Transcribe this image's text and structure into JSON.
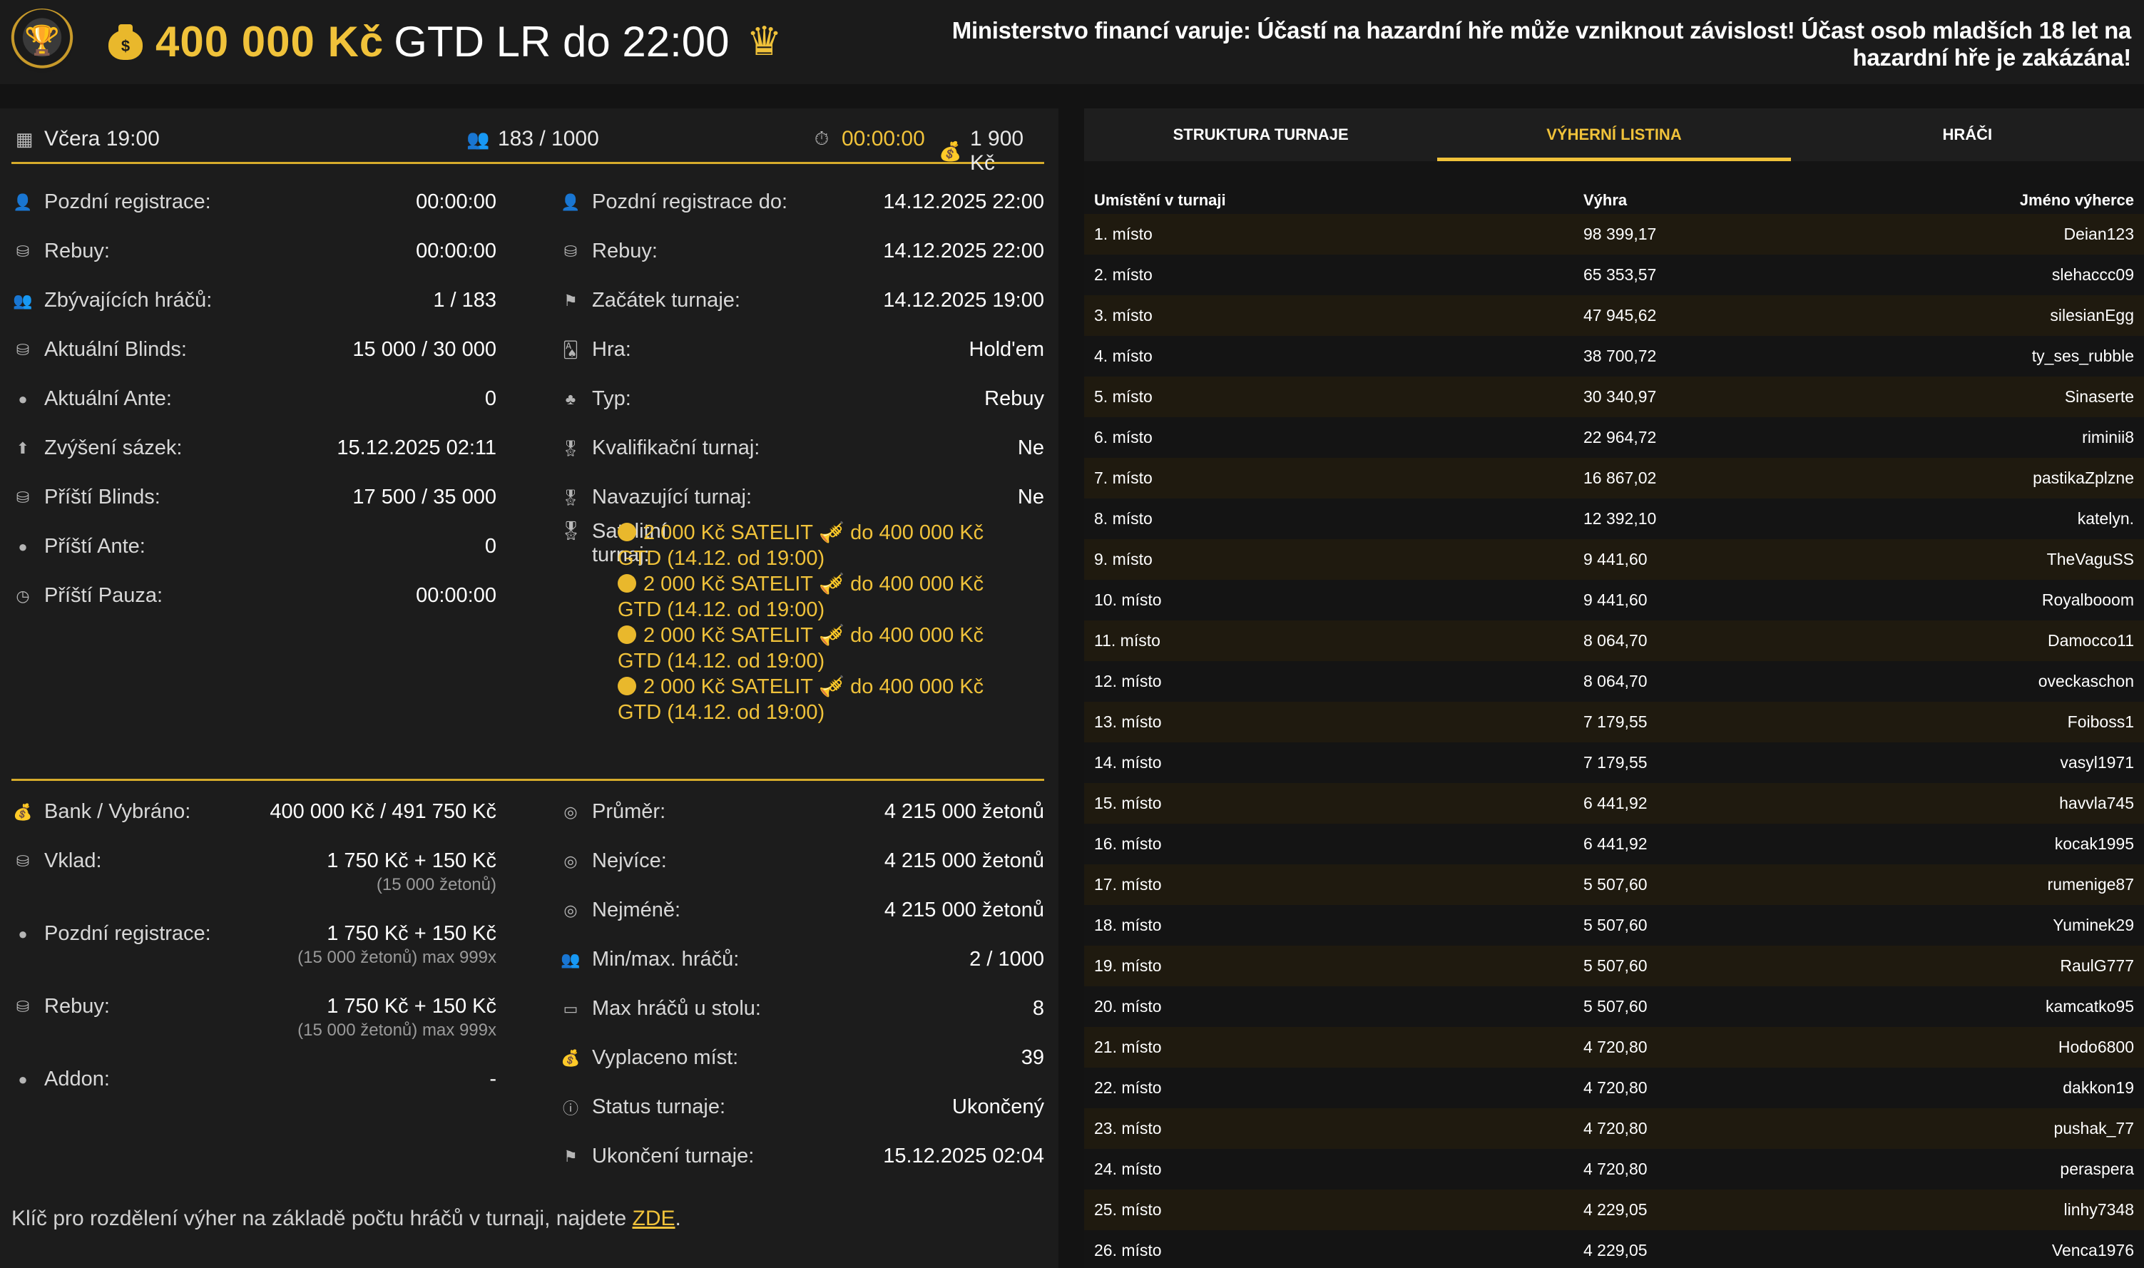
{
  "header": {
    "title_amount": "400 000 Kč",
    "title_rest": "GTD LR do 22:00",
    "warning": "Ministerstvo financí varuje: Účastí na hazardní hře může vzniknout závislost! Účast osob mladších 18 let na hazardní hře je zakázána!"
  },
  "topbar": {
    "date": "Včera 19:00",
    "players": "183 / 1000",
    "timer": "00:00:00",
    "fee": "1 900 Kč"
  },
  "col1": [
    {
      "label": "Pozdní registrace:",
      "value": "00:00:00"
    },
    {
      "label": "Rebuy:",
      "value": "00:00:00"
    },
    {
      "label": "Zbývajících hráčů:",
      "value": "1 / 183"
    },
    {
      "label": "Aktuální Blinds:",
      "value": "15 000 / 30 000"
    },
    {
      "label": "Aktuální Ante:",
      "value": "0"
    },
    {
      "label": "Zvýšení sázek:",
      "value": "15.12.2025 02:11"
    },
    {
      "label": "Příští Blinds:",
      "value": "17 500 / 35 000"
    },
    {
      "label": "Příští Ante:",
      "value": "0"
    },
    {
      "label": "Příští Pauza:",
      "value": "00:00:00"
    }
  ],
  "col2": [
    {
      "label": "Pozdní registrace do:",
      "value": "14.12.2025 22:00"
    },
    {
      "label": "Rebuy:",
      "value": "14.12.2025 22:00"
    },
    {
      "label": "Začátek turnaje:",
      "value": "14.12.2025 19:00"
    },
    {
      "label": "Hra:",
      "value": "Hold'em"
    },
    {
      "label": "Typ:",
      "value": "Rebuy"
    },
    {
      "label": "Kvalifikační turnaj:",
      "value": "Ne"
    },
    {
      "label": "Navazující turnaj:",
      "value": "Ne"
    }
  ],
  "satellite": {
    "label_line1": "Satelitní",
    "label_line2": "turnaj:",
    "items": [
      {
        "name": "2 000 Kč SATELIT",
        "target": "do 400 000 Kč",
        "target2": "GTD (14.12. od 19:00)"
      },
      {
        "name": "2 000 Kč SATELIT",
        "target": "do 400 000 Kč",
        "target2": "GTD (14.12. od 19:00)"
      },
      {
        "name": "2 000 Kč SATELIT",
        "target": "do 400 000 Kč",
        "target2": "GTD (14.12. od 19:00)"
      },
      {
        "name": "2 000 Kč SATELIT",
        "target": "do 400 000 Kč",
        "target2": "GTD (14.12. od 19:00)"
      }
    ]
  },
  "col3": [
    {
      "label": "Bank / Vybráno:",
      "value": "400 000 Kč / 491 750 Kč",
      "sub": ""
    },
    {
      "label": "Vklad:",
      "value": "1 750 Kč + 150 Kč",
      "sub": "(15 000 žetonů)"
    },
    {
      "label": "Pozdní registrace:",
      "value": "1 750 Kč + 150 Kč",
      "sub": "(15 000 žetonů) max 999x"
    },
    {
      "label": "Rebuy:",
      "value": "1 750 Kč + 150 Kč",
      "sub": "(15 000 žetonů) max 999x"
    },
    {
      "label": "Addon:",
      "value": "-",
      "sub": ""
    }
  ],
  "col4": [
    {
      "label": "Průměr:",
      "value": "4 215 000 žetonů"
    },
    {
      "label": "Nejvíce:",
      "value": "4 215 000 žetonů"
    },
    {
      "label": "Nejméně:",
      "value": "4 215 000 žetonů"
    },
    {
      "label": "Min/max. hráčů:",
      "value": "2 / 1000"
    },
    {
      "label": "Max hráčů u stolu:",
      "value": "8"
    },
    {
      "label": "Vyplaceno míst:",
      "value": "39"
    },
    {
      "label": "Status turnaje:",
      "value": "Ukončený"
    },
    {
      "label": "Ukončení turnaje:",
      "value": "15.12.2025 02:04"
    }
  ],
  "footer": {
    "text": "Klíč pro rozdělení výher na základě počtu hráčů v turnaji, najdete ",
    "link": "ZDE",
    "end": "."
  },
  "tabs": [
    "STRUKTURA TURNAJE",
    "VÝHERNÍ LISTINA",
    "HRÁČI"
  ],
  "table": {
    "headers": {
      "place": "Umístění v turnaji",
      "win": "Výhra",
      "name": "Jméno výherce"
    },
    "rows": [
      [
        "1. místo",
        "98 399,17",
        "Deian123"
      ],
      [
        "2. místo",
        "65 353,57",
        "slehaccc09"
      ],
      [
        "3. místo",
        "47 945,62",
        "silesianEgg"
      ],
      [
        "4. místo",
        "38 700,72",
        "ty_ses_rubble"
      ],
      [
        "5. místo",
        "30 340,97",
        "Sinaserte"
      ],
      [
        "6. místo",
        "22 964,72",
        "riminii8"
      ],
      [
        "7. místo",
        "16 867,02",
        "pastikaZplzne"
      ],
      [
        "8. místo",
        "12 392,10",
        "katelyn."
      ],
      [
        "9. místo",
        "9 441,60",
        "TheVaguSS"
      ],
      [
        "10. místo",
        "9 441,60",
        "Royalbooom"
      ],
      [
        "11. místo",
        "8 064,70",
        "Damocco11"
      ],
      [
        "12. místo",
        "8 064,70",
        "oveckaschon"
      ],
      [
        "13. místo",
        "7 179,55",
        "Foiboss1"
      ],
      [
        "14. místo",
        "7 179,55",
        "vasyl1971"
      ],
      [
        "15. místo",
        "6 441,92",
        "havvla745"
      ],
      [
        "16. místo",
        "6 441,92",
        "kocak1995"
      ],
      [
        "17. místo",
        "5 507,60",
        "rumenige87"
      ],
      [
        "18. místo",
        "5 507,60",
        "Yuminek29"
      ],
      [
        "19. místo",
        "5 507,60",
        "RaulG777"
      ],
      [
        "20. místo",
        "5 507,60",
        "kamcatko95"
      ],
      [
        "21. místo",
        "4 720,80",
        "Hodo6800"
      ],
      [
        "22. místo",
        "4 720,80",
        "dakkon19"
      ],
      [
        "23. místo",
        "4 720,80",
        "pushak_77"
      ],
      [
        "24. místo",
        "4 720,80",
        "peraspera"
      ],
      [
        "25. místo",
        "4 229,05",
        "linhy7348"
      ],
      [
        "26. místo",
        "4 229,05",
        "Venca1976"
      ]
    ]
  }
}
